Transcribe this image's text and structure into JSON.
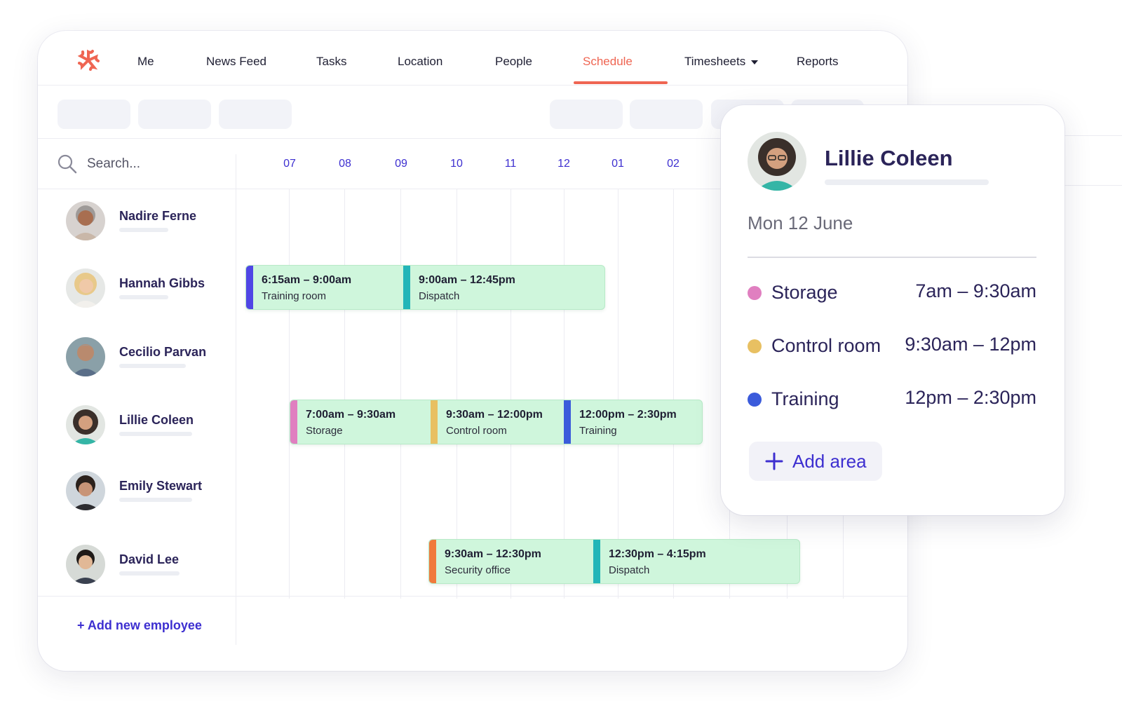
{
  "nav": {
    "items": [
      {
        "label": "Me"
      },
      {
        "label": "News Feed"
      },
      {
        "label": "Tasks"
      },
      {
        "label": "Location"
      },
      {
        "label": "People"
      },
      {
        "label": "Schedule"
      },
      {
        "label": "Timesheets"
      },
      {
        "label": "Reports"
      }
    ],
    "active": "Schedule",
    "logo_icon": "asterisk-logo-icon"
  },
  "search": {
    "placeholder": "Search..."
  },
  "timeline": {
    "hours": [
      "07",
      "08",
      "09",
      "10",
      "11",
      "12",
      "01",
      "02"
    ]
  },
  "employees": [
    {
      "name": "Nadire Ferne"
    },
    {
      "name": "Hannah Gibbs"
    },
    {
      "name": "Cecilio Parvan"
    },
    {
      "name": "Lillie Coleen"
    },
    {
      "name": "Emily Stewart"
    },
    {
      "name": "David Lee"
    }
  ],
  "shifts": {
    "hannah": [
      {
        "time": "6:15am – 9:00am",
        "area": "Training room",
        "color": "#4f46e5"
      },
      {
        "time": "9:00am – 12:45pm",
        "area": "Dispatch",
        "color": "#22b5b8"
      }
    ],
    "lillie": [
      {
        "time": "7:00am – 9:30am",
        "area": "Storage",
        "color": "#e07fc0"
      },
      {
        "time": "9:30am – 12:00pm",
        "area": "Control room",
        "color": "#e8c062"
      },
      {
        "time": "12:00pm – 2:30pm",
        "area": "Training",
        "color": "#3b5bdb"
      }
    ],
    "david": [
      {
        "time": "9:30am – 12:30pm",
        "area": "Security office",
        "color": "#f07a3c"
      },
      {
        "time": "12:30pm – 4:15pm",
        "area": "Dispatch",
        "color": "#22b5b8"
      }
    ]
  },
  "add_employee": "+ Add new employee",
  "detail": {
    "name": "Lillie Coleen",
    "date": "Mon 12 June",
    "areas": [
      {
        "area": "Storage",
        "time": "7am – 9:30am",
        "color": "#e07fc0"
      },
      {
        "area": "Control room",
        "time": "9:30am – 12pm",
        "color": "#e8c062"
      },
      {
        "area": "Training",
        "time": "12pm – 2:30pm",
        "color": "#3b5bdb"
      }
    ],
    "add_area": "Add area"
  },
  "colors": {
    "accent": "#ef6552",
    "brand": "#3d2fd0",
    "shift_bg": "#cff6dc"
  }
}
